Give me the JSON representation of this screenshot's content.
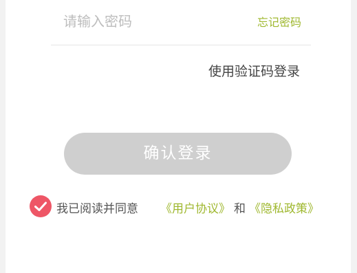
{
  "password": {
    "placeholder": "请输入密码",
    "value": "",
    "forgot_label": "忘记密码"
  },
  "sms_login_label": "使用验证码登录",
  "confirm_button_label": "确认登录",
  "agreement": {
    "checked": true,
    "prefix": "我已阅读并同意",
    "user_agreement": "《用户协议》",
    "and": "和",
    "privacy_policy": "《隐私政策》"
  },
  "colors": {
    "accent_green": "#9fb82f",
    "checkbox_red": "#ee5666",
    "button_disabled": "#cfcfcf"
  },
  "icons": {
    "checkbox": "check-circle-icon"
  }
}
